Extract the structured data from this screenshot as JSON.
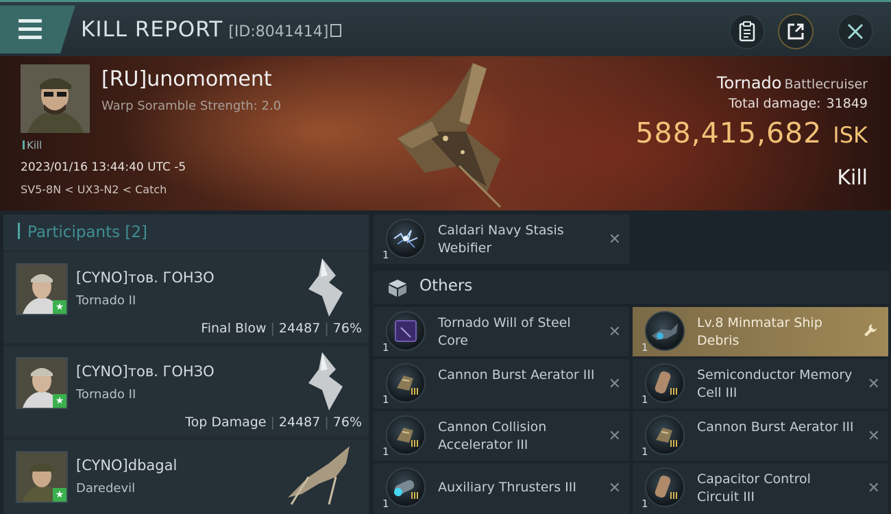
{
  "header": {
    "title": "KILL REPORT",
    "report_id": "[ID:8041414]"
  },
  "victim": {
    "name": "[RU]unomoment",
    "subtitle": "Warp Soramble Strength: 2.0",
    "tag": "Kill",
    "datetime": "2023/01/16 13:44:40 UTC -5",
    "location": "SV5-8N < UX3-N2 < Catch",
    "ship_name": "Tornado",
    "ship_class": "Battlecruiser",
    "damage_label": "Total damage:",
    "damage_value": "31849",
    "isk_value": "588,415,682",
    "isk_unit": "ISK",
    "result": "Kill"
  },
  "participants": {
    "title": "Participants",
    "count": "[2]",
    "rows": [
      {
        "name": "[CYNO]тов. ГОНЗО",
        "ship": "Tornado II",
        "label": "Final Blow",
        "damage": "24487",
        "percent": "76%"
      },
      {
        "name": "[CYNO]тов. ГОНЗО",
        "ship": "Tornado II",
        "label": "Top Damage",
        "damage": "24487",
        "percent": "76%"
      },
      {
        "name": "[CYNO]dbagal",
        "ship": "Daredevil"
      }
    ]
  },
  "items": {
    "top": {
      "name": "Caldari Navy Stasis Webifier",
      "qty": "1"
    },
    "others_label": "Others",
    "others": [
      {
        "name": "Tornado Will of Steel Core",
        "qty": "1"
      },
      {
        "name": "Lv.8 Minmatar Ship Debris",
        "qty": "1",
        "highlighted": true
      },
      {
        "name": "Cannon Burst Aerator III",
        "qty": "1"
      },
      {
        "name": "Semiconductor Memory Cell III",
        "qty": "1"
      },
      {
        "name": "Cannon Collision Accelerator III",
        "qty": "1"
      },
      {
        "name": "Cannon Burst Aerator III",
        "qty": "1"
      },
      {
        "name": "Auxiliary Thrusters III",
        "qty": "1"
      },
      {
        "name": "Capacitor Control Circuit III",
        "qty": "1"
      }
    ]
  },
  "colors": {
    "accent_teal": "#4ea7a0",
    "isk_gold": "#f1c277",
    "highlight_gold": "#a08957"
  }
}
